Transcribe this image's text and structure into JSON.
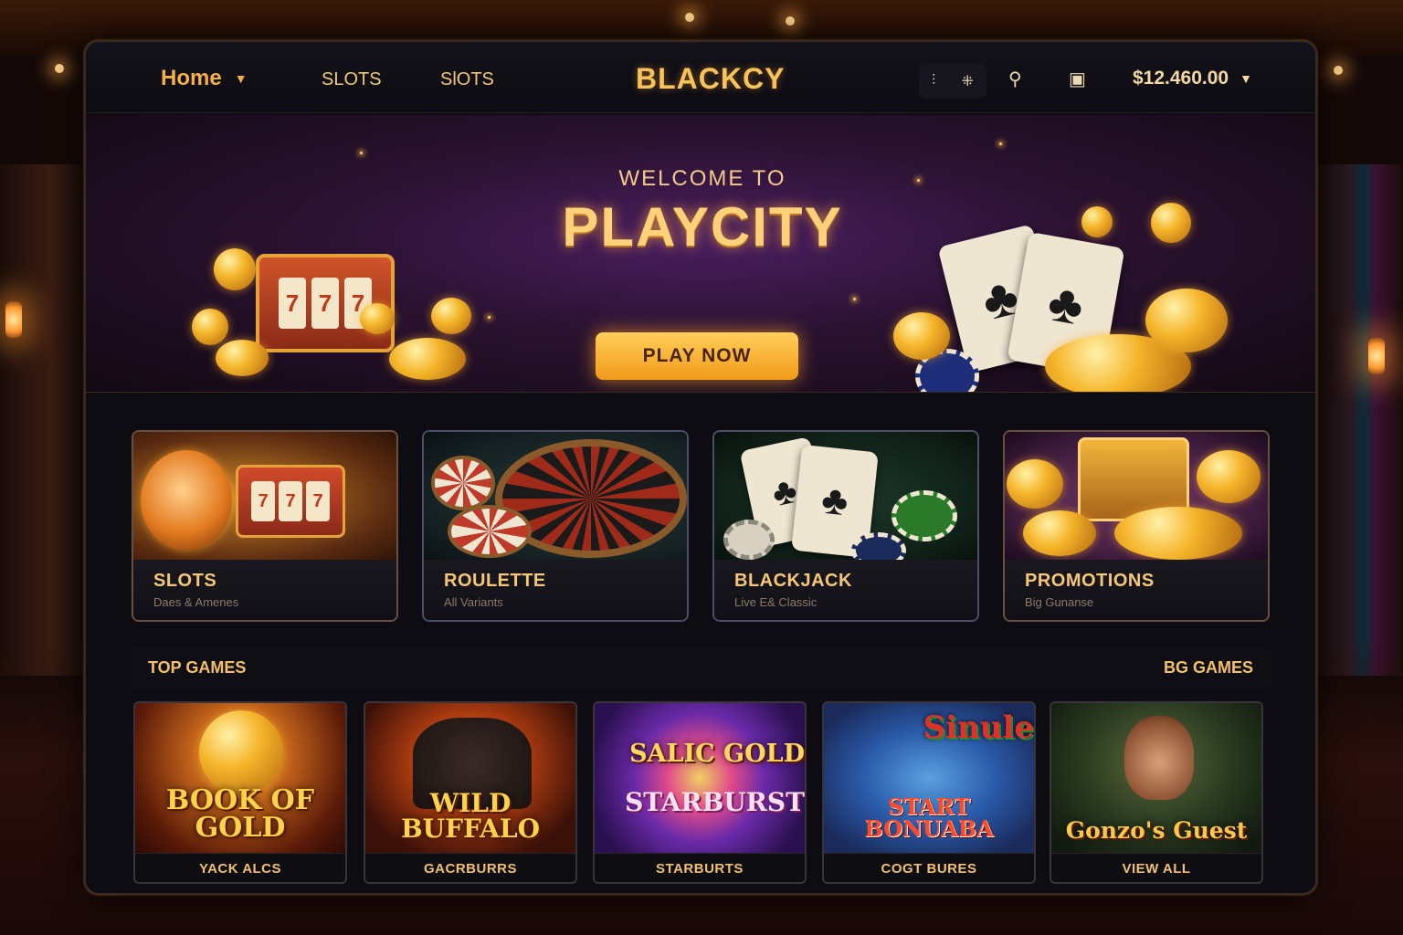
{
  "header": {
    "home_label": "Home",
    "nav_links": [
      "SLOTS",
      "SlOTS"
    ],
    "brand": "BLACKCY",
    "icon_group": [
      "⫶",
      "⁜"
    ],
    "balance": "$12.460.00"
  },
  "hero": {
    "welcome": "WELCOME TO",
    "title": "PLAYCITY",
    "cta": "PLAY NOW"
  },
  "categories": [
    {
      "title": "SLOTS",
      "subtitle": "Daes & Amenes"
    },
    {
      "title": "ROULETTE",
      "subtitle": "All Variants"
    },
    {
      "title": "BLACKJACK",
      "subtitle": "Live E& Classic"
    },
    {
      "title": "PROMOTIONS",
      "subtitle": "Big Gunanse"
    }
  ],
  "top_games": {
    "heading": "TOP GAMES",
    "more_link": "BG GAMES",
    "games": [
      {
        "art_title": "BOOK OF GOLD",
        "label": "YACK ALCS"
      },
      {
        "art_title": "WILD BUFFALO",
        "label": "GACRBURRS"
      },
      {
        "art_title_top": "SALIC GOLD",
        "art_title": "STARBURST",
        "label": "STARBURTS"
      },
      {
        "art_title_top": "Sinule",
        "art_title": "START BONUABA",
        "label": "COGT BURES"
      },
      {
        "art_title": "Gonzo's Guest",
        "label": "VIEW ALL"
      }
    ]
  },
  "colors": {
    "accent": "#f4b047",
    "gold_text": "#ffd27a",
    "panel": "#0d0c12"
  },
  "icons": [
    "chevron-down-icon",
    "grip-icon",
    "settings-icon",
    "search-icon",
    "wallet-icon"
  ]
}
